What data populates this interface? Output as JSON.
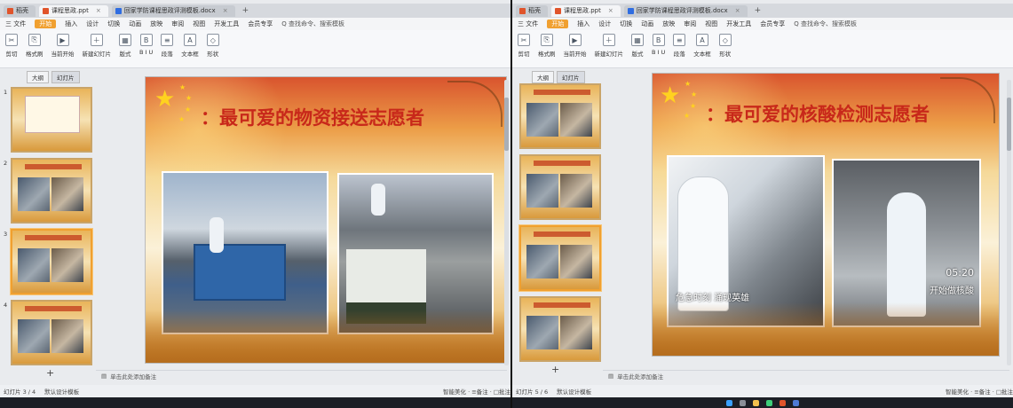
{
  "left": {
    "tabs": [
      {
        "label": "稻壳",
        "icon_color": "#e0542b"
      },
      {
        "label": "课程思政.ppt",
        "icon_color": "#e0542b"
      },
      {
        "label": "回家学防课程思政评测模板.docx",
        "icon_color": "#2f6de1"
      }
    ],
    "menu": {
      "file": "三 文件",
      "start": "开始",
      "items": [
        "插入",
        "设计",
        "切换",
        "动画",
        "放映",
        "审阅",
        "视图",
        "开发工具",
        "会员专享"
      ],
      "search": "Q 查找命令、搜索模板"
    },
    "ribbon": [
      {
        "glyph": "✂",
        "label": "剪切"
      },
      {
        "glyph": "⎘",
        "label": "格式刷"
      },
      {
        "glyph": "▶",
        "label": "当前开始"
      },
      {
        "glyph": "＋",
        "label": "新建幻灯片"
      },
      {
        "glyph": "▦",
        "label": "版式"
      },
      {
        "glyph": "B",
        "label": "B I U"
      },
      {
        "glyph": "≡",
        "label": "段落"
      },
      {
        "glyph": "A",
        "label": "文本框"
      },
      {
        "glyph": "◇",
        "label": "形状"
      }
    ],
    "side_tabs": [
      "大纲",
      "幻灯片"
    ],
    "slide": {
      "title": "：最可爱的物资接送志愿者"
    },
    "notes": "单击此处添加备注",
    "status": {
      "slide_count": "幻灯片 3 / 4",
      "theme": "默认设计模板",
      "right": "智能美化 · ≡备注 · □批注"
    }
  },
  "right": {
    "tabs": [
      {
        "label": "稻壳",
        "icon_color": "#e0542b"
      },
      {
        "label": "课程思政.ppt",
        "icon_color": "#e0542b"
      },
      {
        "label": "回家学防课程思政评测模板.docx",
        "icon_color": "#2f6de1"
      }
    ],
    "menu": {
      "file": "三 文件",
      "start": "开始",
      "items": [
        "插入",
        "设计",
        "切换",
        "动画",
        "放映",
        "审阅",
        "视图",
        "开发工具",
        "会员专享"
      ],
      "search": "Q 查找命令、搜索模板"
    },
    "ribbon": [
      {
        "glyph": "✂",
        "label": "剪切"
      },
      {
        "glyph": "⎘",
        "label": "格式刷"
      },
      {
        "glyph": "▶",
        "label": "当前开始"
      },
      {
        "glyph": "＋",
        "label": "新建幻灯片"
      },
      {
        "glyph": "▦",
        "label": "版式"
      },
      {
        "glyph": "B",
        "label": "B I U"
      },
      {
        "glyph": "≡",
        "label": "段落"
      },
      {
        "glyph": "A",
        "label": "文本框"
      },
      {
        "glyph": "◇",
        "label": "形状"
      }
    ],
    "side_tabs": [
      "大纲",
      "幻灯片"
    ],
    "slide": {
      "title": "：最可爱的核酸检测志愿者",
      "caption_left": "危急时刻 涌现英雄",
      "caption_time": "05:20",
      "caption_right": "开始做核酸"
    },
    "notes": "单击此处添加备注",
    "status": {
      "slide_count": "幻灯片 5 / 6",
      "theme": "默认设计模板",
      "right": "智能美化 · ≡备注 · □批注"
    }
  },
  "colors": {
    "accent": "#f0a030",
    "title_red": "#c8281a",
    "star": "#ffd21f"
  }
}
